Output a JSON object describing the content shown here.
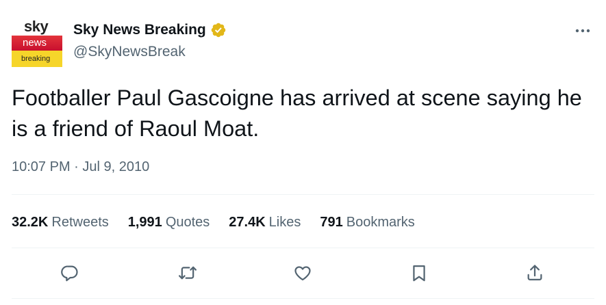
{
  "account": {
    "display_name": "Sky News Breaking",
    "handle": "@SkyNewsBreak",
    "verified": true,
    "avatar": {
      "line1": "sky",
      "line2": "news",
      "line3": "breaking",
      "colors": {
        "red": "#d52430",
        "yellow": "#f6d52a"
      }
    }
  },
  "tweet": {
    "text": "Footballer Paul Gascoigne has arrived at scene saying he is a friend of Raoul Moat.",
    "timestamp": "10:07 PM · Jul 9, 2010"
  },
  "stats": [
    {
      "count": "32.2K",
      "label": "Retweets"
    },
    {
      "count": "1,991",
      "label": "Quotes"
    },
    {
      "count": "27.4K",
      "label": "Likes"
    },
    {
      "count": "791",
      "label": "Bookmarks"
    }
  ],
  "actions": [
    "reply-icon",
    "retweet-icon",
    "like-icon",
    "bookmark-icon",
    "share-icon"
  ],
  "colors": {
    "text": "#0f1419",
    "secondary": "#536471",
    "divider": "#eff3f4",
    "verified_gold": "#e2b719"
  }
}
